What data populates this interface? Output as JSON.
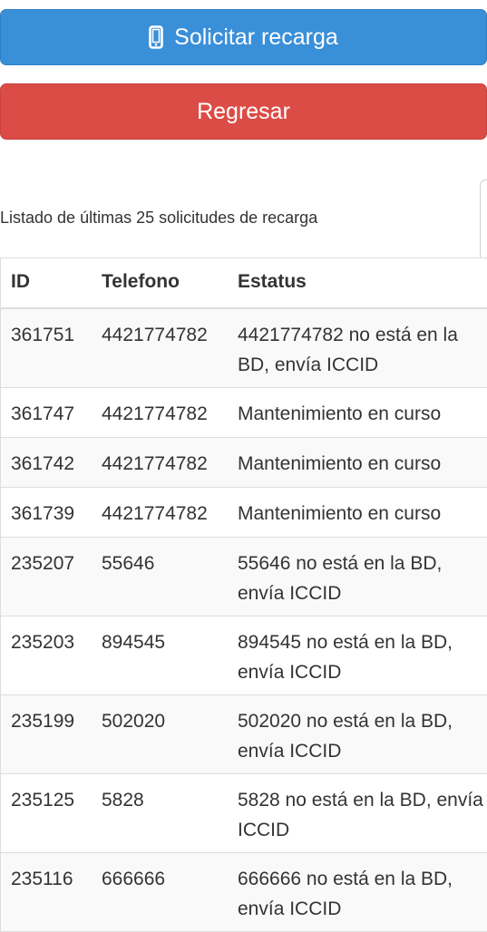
{
  "buttons": {
    "request_label": "Solicitar recarga",
    "back_label": "Regresar"
  },
  "caption": "Listado de últimas 25 solicitudes de recarga",
  "table": {
    "headers": [
      "ID",
      "Telefono",
      "Estatus"
    ],
    "rows": [
      {
        "id": "361751",
        "phone": "4421774782",
        "status": "4421774782 no está en la BD, envía ICCID"
      },
      {
        "id": "361747",
        "phone": "4421774782",
        "status": "Mantenimiento en curso"
      },
      {
        "id": "361742",
        "phone": "4421774782",
        "status": "Mantenimiento en curso"
      },
      {
        "id": "361739",
        "phone": "4421774782",
        "status": "Mantenimiento en curso"
      },
      {
        "id": "235207",
        "phone": "55646",
        "status": "55646 no está en la BD, envía ICCID"
      },
      {
        "id": "235203",
        "phone": "894545",
        "status": "894545 no está en la BD, envía ICCID"
      },
      {
        "id": "235199",
        "phone": "502020",
        "status": "502020 no está en la BD, envía ICCID"
      },
      {
        "id": "235125",
        "phone": "5828",
        "status": "5828 no está en la BD, envía ICCID"
      },
      {
        "id": "235116",
        "phone": "666666",
        "status": "666666 no está en la BD, envía ICCID"
      }
    ]
  },
  "icons": {
    "request_button_icon": "mobile-phone-icon"
  },
  "colors": {
    "primary": "#3a8fd9",
    "danger": "#db4c46"
  }
}
